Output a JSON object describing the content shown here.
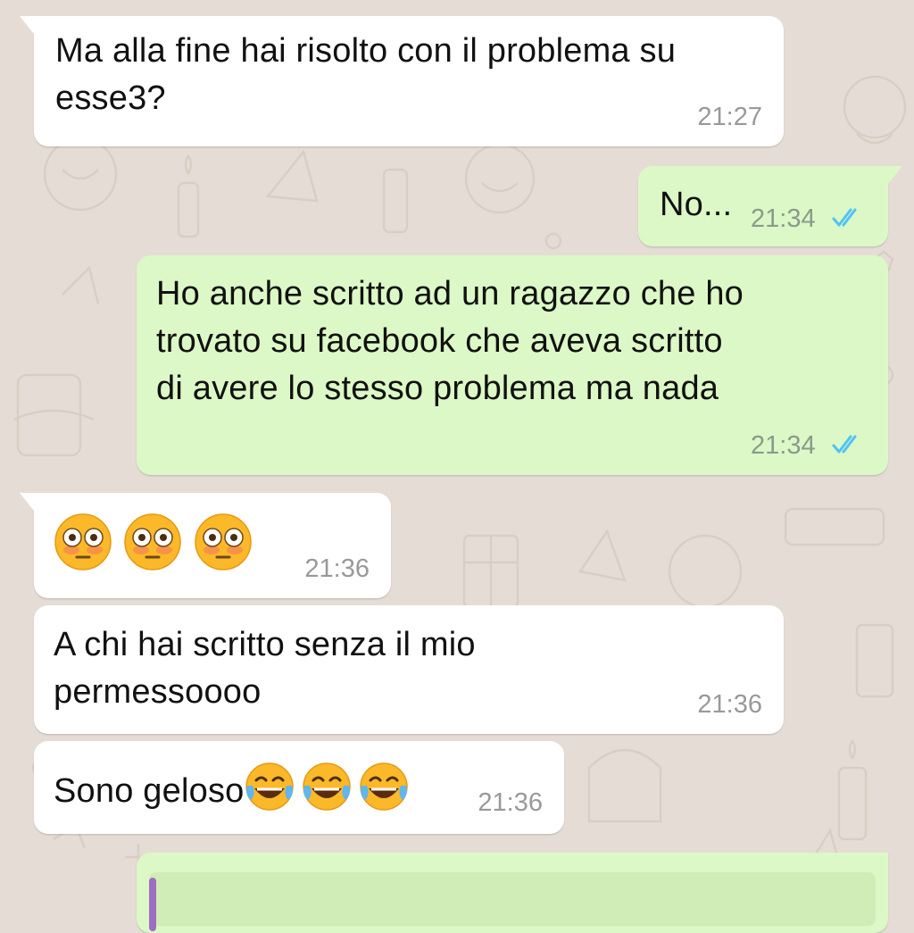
{
  "messages": [
    {
      "direction": "incoming",
      "text": "Ma alla fine hai risolto con il problema su\nesse3?",
      "time": "21:27"
    },
    {
      "direction": "outgoing",
      "text": "No...",
      "time": "21:34",
      "status": "read"
    },
    {
      "direction": "outgoing",
      "text": "Ho anche scritto ad un ragazzo che ho\ntrovato su facebook che aveva scritto\ndi avere lo stesso problema ma nada",
      "time": "21:34",
      "status": "read"
    },
    {
      "direction": "incoming",
      "emoji": [
        "flushed-face-emoji",
        "flushed-face-emoji",
        "flushed-face-emoji"
      ],
      "time": "21:36"
    },
    {
      "direction": "incoming",
      "text": "A chi hai scritto senza il mio\npermessoooo",
      "time": "21:36"
    },
    {
      "direction": "incoming",
      "text": "Sono geloso",
      "emoji": [
        "tears-of-joy-emoji",
        "tears-of-joy-emoji",
        "tears-of-joy-emoji"
      ],
      "time": "21:36"
    }
  ],
  "colors": {
    "wallpaper": "#e5ddd5",
    "incoming_bubble": "#ffffff",
    "outgoing_bubble": "#dcf8c6",
    "read_ticks": "#4fc3f7",
    "quote_accent": "#9c6fc2"
  }
}
